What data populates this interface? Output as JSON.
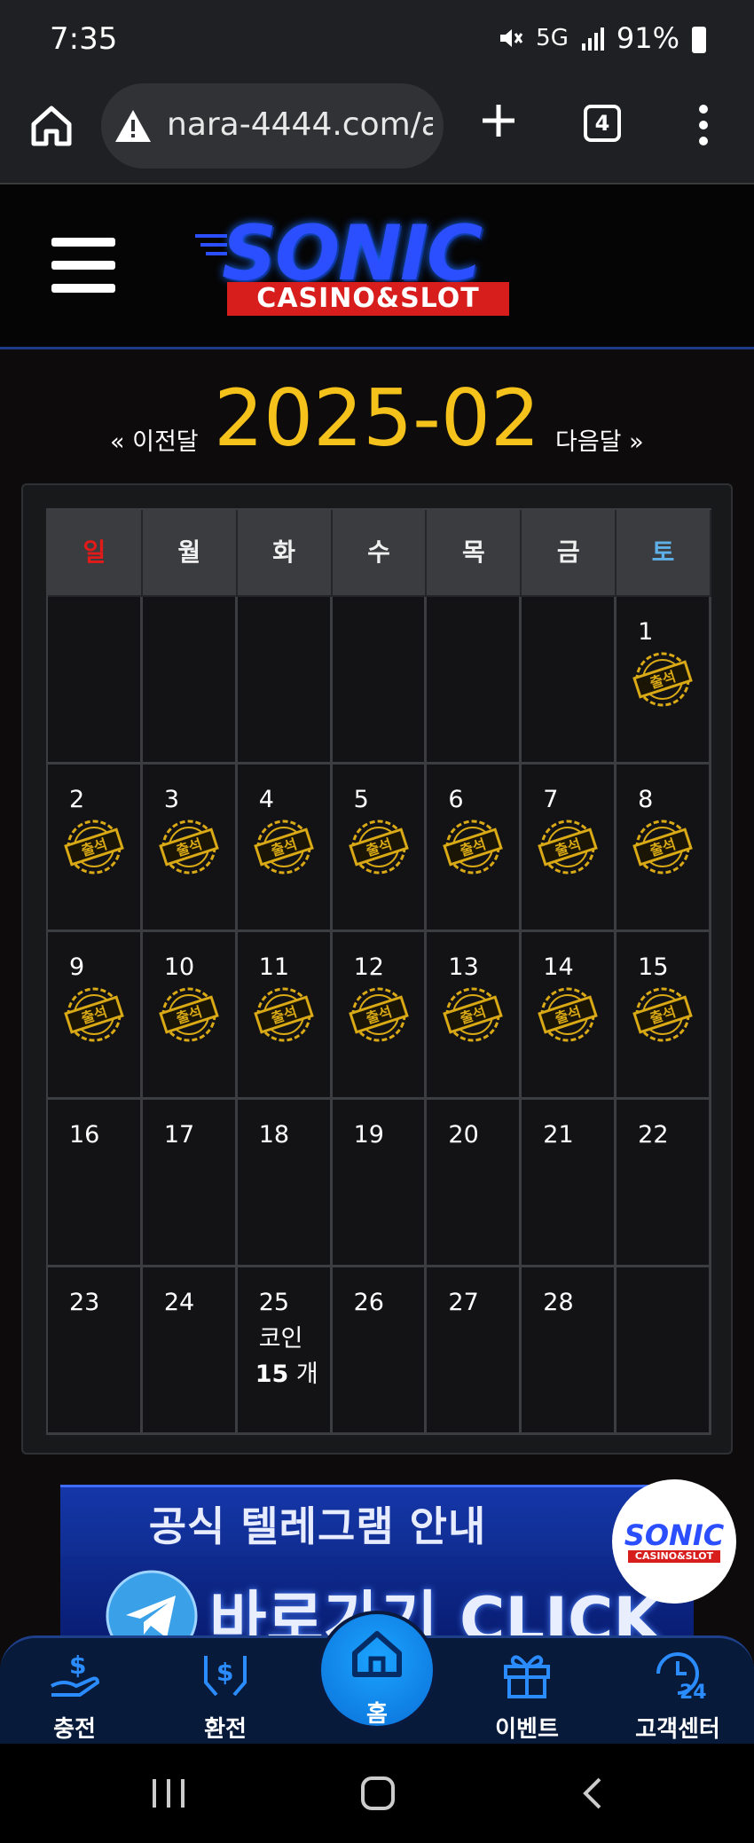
{
  "status": {
    "time": "7:35",
    "network": "5G",
    "battery": "91%"
  },
  "browser": {
    "url": "nara-4444.com/a",
    "tab_count": "4"
  },
  "logo": {
    "title": "SONIC",
    "subtitle": "CASINO&SLOT"
  },
  "calendar": {
    "month": "2025-02",
    "prev_label": "« 이전달",
    "next_label": "다음달 »",
    "weekdays": [
      "일",
      "월",
      "화",
      "수",
      "목",
      "금",
      "토"
    ],
    "attended_stamp_label": "출석",
    "days": [
      "",
      "",
      "",
      "",
      "",
      "",
      "1",
      "2",
      "3",
      "4",
      "5",
      "6",
      "7",
      "8",
      "9",
      "10",
      "11",
      "12",
      "13",
      "14",
      "15",
      "16",
      "17",
      "18",
      "19",
      "20",
      "21",
      "22",
      "23",
      "24",
      "25",
      "26",
      "27",
      "28",
      ""
    ],
    "attended_days": [
      "1",
      "2",
      "3",
      "4",
      "5",
      "6",
      "7",
      "8",
      "9",
      "10",
      "11",
      "12",
      "13",
      "14",
      "15"
    ],
    "coin_day": "25",
    "coin_label": "코인",
    "coin_amount": "15",
    "coin_unit": "개"
  },
  "banner": {
    "title": "공식 텔레그램 안내",
    "cta": "바로가기 CLICK",
    "badge_title": "SONIC",
    "badge_sub": "CASINO&SLOT"
  },
  "bottom_nav": {
    "deposit": "충전",
    "withdraw": "환전",
    "home": "홈",
    "event": "이벤트",
    "support": "고객센터"
  },
  "colors": {
    "month_accent": "#f4c21b",
    "sunday": "#e21a1a",
    "saturday": "#5fb0e6",
    "stamp_gold": "#d9a916",
    "nav_blue": "#1ba3ff"
  }
}
